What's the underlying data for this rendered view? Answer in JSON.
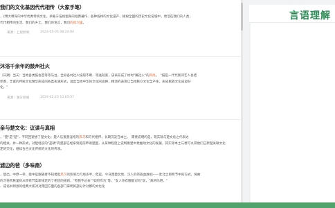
{
  "sidebar": {
    "title": "言语理解"
  },
  "articles": [
    {
      "title": "我们的文化基因代代相传（大家手笔）",
      "lines": [
        {
          "pre": "，《博大精深的中华优秀传统文化，承载于浩如烟海的经典著作、各种各样的文化遗产，植根全国的历史文化名城中，更活在我们的人类，",
          "hl": "",
          "post": ""
        },
        {
          "pre": "代代相传的生活、我们的乡土，我们的语言，我们",
          "hl": "的风习里",
          "post": "。"
        }
      ],
      "source": "来源：上观新闻",
      "time": "2024-05-05 08:24:04"
    },
    {
      "title": "沐浴千余年的鼓州社火",
      "lines": [
        {
          "pre": "（日期）当天：当地各类鼓会首等等马台，全县各村社火按照不断、等送就紧，该采形成了村村\"赛社火\"的",
          "hl": "风尚",
          "post": "。　\"鼓是一代代民间艺人总结"
        },
        {
          "pre": "完善、丰富的传统文化精华形成的各类表演形式，溢出当地中华的文化的追捧，精湛的表演让当地民众文化全产生，形成民族文化成良好",
          "hl": "",
          "post": ""
        },
        {
          "pre": "化。\"",
          "hl": "",
          "post": ""
        }
      ],
      "source": "来源：潮方新闻",
      "time": "2024-02-23 10:03:37"
    },
    {
      "title": "亲与楚文化：议读与真相",
      "lines": [
        {
          "pre": "，\"楚\"是\"楚\"，不同回避想了楚文化；楚人信鬼重淫祀的",
          "hl": "风习",
          "post": "和习代相传，长期沉淀在本土。　需要说明的是，现实就与楚文化之代表达"
        },
        {
          "pre": "的相关，并一种形式，对楚经说的\"巫覡\"有楚部已经拿到提前申请楚国，从某种程度上说制衡楚中更推动文化的发展，其实际本土与者可以得他们已新楚关联文化"
        },
        {
          "pre": "定的交化，继续合合文化传统的文化的传承。",
          "hl": "",
          "post": ""
        }
      ],
      "source": "",
      "time": ""
    },
    {
      "title": "滤边的爸（多味斋）",
      "lines": [
        {
          "pre": "，楚出，中原一带，能中是跟随者不知者起",
          "hl": "风习",
          "post": "的影响力几经多半。但是，今日西楚北地，汉人的宗族血脉如——赴北之目和节中的方式，将故"
        },
        {
          "pre": "的习俗宗族里的从跨有节类新规定的了相应的规则，\"有我不过去\"\"如何作为\"等，\"女人你衣服能对吗\"说，\"真的吗吧。\"",
          "hl": "",
          "post": ""
        },
        {
          "pre": "、成语书到意的经典大家对对用回方面的各部门来明的部分计对那的文化化",
          "hl": "",
          "post": ""
        }
      ],
      "source": "",
      "time": ""
    }
  ]
}
